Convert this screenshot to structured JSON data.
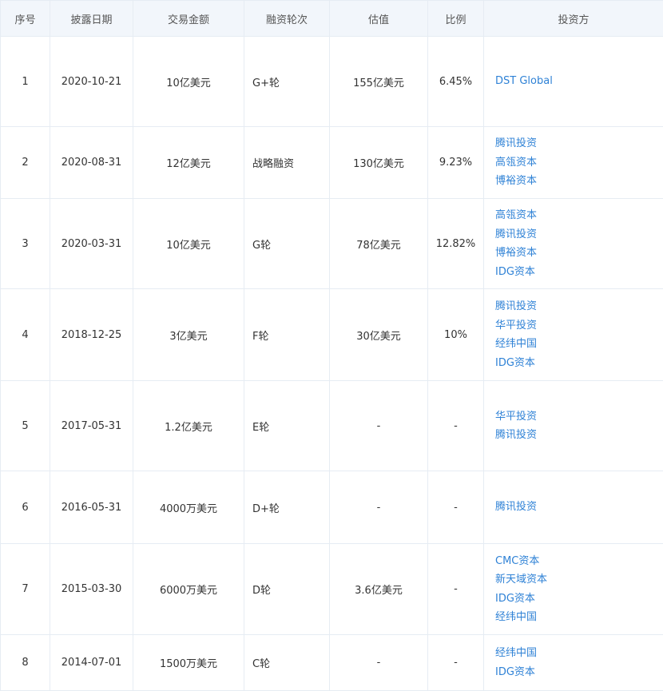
{
  "table": {
    "headers": [
      "序号",
      "披露日期",
      "交易金额",
      "融资轮次",
      "估值",
      "比例",
      "投资方"
    ],
    "rows": [
      {
        "index": "1",
        "date": "2020-10-21",
        "amount": "10亿美元",
        "round": "G+轮",
        "valuation": "155亿美元",
        "ratio": "6.45%",
        "investors": [
          "DST Global"
        ]
      },
      {
        "index": "2",
        "date": "2020-08-31",
        "amount": "12亿美元",
        "round": "战略融资",
        "valuation": "130亿美元",
        "ratio": "9.23%",
        "investors": [
          "腾讯投资",
          "高瓴资本",
          "博裕资本"
        ]
      },
      {
        "index": "3",
        "date": "2020-03-31",
        "amount": "10亿美元",
        "round": "G轮",
        "valuation": "78亿美元",
        "ratio": "12.82%",
        "investors": [
          "高瓴资本",
          "腾讯投资",
          "博裕资本",
          "IDG资本"
        ]
      },
      {
        "index": "4",
        "date": "2018-12-25",
        "amount": "3亿美元",
        "round": "F轮",
        "valuation": "30亿美元",
        "ratio": "10%",
        "investors": [
          "腾讯投资",
          "华平投资",
          "经纬中国",
          "IDG资本"
        ]
      },
      {
        "index": "5",
        "date": "2017-05-31",
        "amount": "1.2亿美元",
        "round": "E轮",
        "valuation": "-",
        "ratio": "-",
        "investors": [
          "华平投资",
          "腾讯投资"
        ]
      },
      {
        "index": "6",
        "date": "2016-05-31",
        "amount": "4000万美元",
        "round": "D+轮",
        "valuation": "-",
        "ratio": "-",
        "investors": [
          "腾讯投资"
        ]
      },
      {
        "index": "7",
        "date": "2015-03-30",
        "amount": "6000万美元",
        "round": "D轮",
        "valuation": "3.6亿美元",
        "ratio": "-",
        "investors": [
          "CMC资本",
          "新天域资本",
          "IDG资本",
          "经纬中国"
        ]
      },
      {
        "index": "8",
        "date": "2014-07-01",
        "amount": "1500万美元",
        "round": "C轮",
        "valuation": "-",
        "ratio": "-",
        "investors": [
          "经纬中国",
          "IDG资本"
        ]
      }
    ]
  }
}
